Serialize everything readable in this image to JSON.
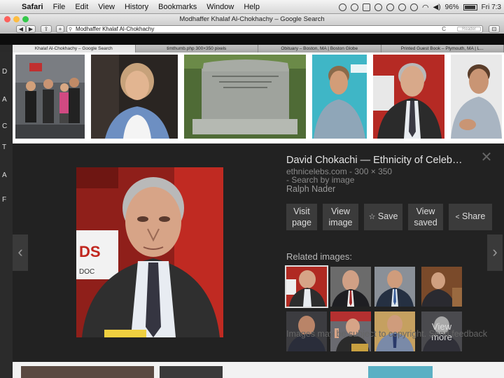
{
  "menubar": {
    "app": "Safari",
    "items": [
      "File",
      "Edit",
      "View",
      "History",
      "Bookmarks",
      "Window",
      "Help"
    ],
    "battery": "96%",
    "clock": "Fri 7:3"
  },
  "window": {
    "title": "Modhaffer Khalaf Al-Chokhachy – Google Search"
  },
  "toolbar": {
    "back_label": "◀",
    "forward_label": "▶",
    "add_label": "+",
    "address": "Modhaffer Khalaf Al-Chokhachy",
    "reload_label": "C",
    "reader_label": "Reader"
  },
  "tabs": [
    "Khalaf Al-Chokhachy – Google Search",
    "timthumb.php 300×350 pixels",
    "Obituary – Boston, MA | Boston Globe",
    "Printed Guest Book – Plymouth, MA | L..."
  ],
  "left_edge_letters": [
    "D",
    "A",
    "C",
    "T",
    "A",
    "F"
  ],
  "preview": {
    "title": "David Chokachi — Ethnicity of Celeb…",
    "source": "ethnicelebs.com - 300 × 350",
    "search_by_image": "- Search by image",
    "subject": "Ralph Nader",
    "close_label": "✕",
    "prev_label": "‹",
    "next_label": "›",
    "actions": {
      "visit_line1": "Visit",
      "visit_line2": "page",
      "view_line1": "View",
      "view_line2": "image",
      "save": "Save",
      "save_icon": "☆",
      "saved_line1": "View",
      "saved_line2": "saved",
      "share": "Share",
      "share_icon": "<"
    },
    "related_label": "Related images:",
    "view_more_line1": "View",
    "view_more_line2": "more",
    "copyright": "Images may be subject to copyright. Send feedback"
  },
  "colors": {
    "panel_bg": "#222222",
    "button_bg": "#3b3b3b",
    "traffic_red": "#fc605b",
    "traffic_yellow": "#fdbc40",
    "traffic_green": "#34c84a"
  }
}
